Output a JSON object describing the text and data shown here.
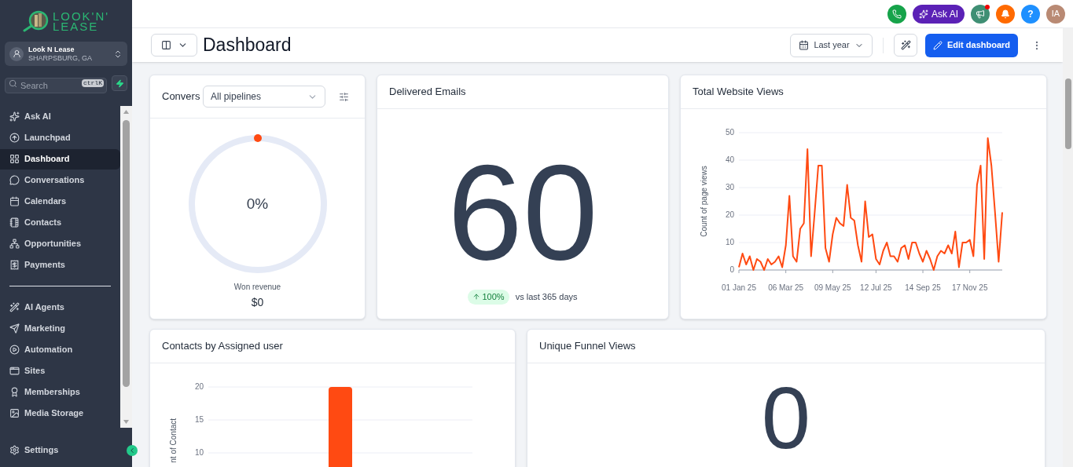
{
  "logo": {
    "line_1": "LOOK'N'",
    "line_2": "LEASE"
  },
  "account": {
    "name": "Look N Lease",
    "location": "SHARPSBURG, GA"
  },
  "search": {
    "placeholder": "Search",
    "shortcut": "ctrlK"
  },
  "sidebar": {
    "groups": [
      {
        "items": [
          {
            "label": "Ask AI",
            "selected": false
          },
          {
            "label": "Launchpad",
            "selected": false
          },
          {
            "label": "Dashboard",
            "selected": true
          },
          {
            "label": "Conversations",
            "selected": false
          },
          {
            "label": "Calendars",
            "selected": false
          },
          {
            "label": "Contacts",
            "selected": false
          },
          {
            "label": "Opportunities",
            "selected": false
          },
          {
            "label": "Payments",
            "selected": false
          }
        ]
      },
      {
        "items": [
          {
            "label": "AI Agents",
            "selected": false
          },
          {
            "label": "Marketing",
            "selected": false
          },
          {
            "label": "Automation",
            "selected": false
          },
          {
            "label": "Sites",
            "selected": false
          },
          {
            "label": "Memberships",
            "selected": false
          },
          {
            "label": "Media Storage",
            "selected": false
          }
        ]
      }
    ],
    "footer_item": "Settings"
  },
  "topbar": {
    "ask_ai": "Ask AI",
    "announcements_unread": true,
    "help": "?",
    "avatar_initials": "IA"
  },
  "header": {
    "title": "Dashboard",
    "date_range": "Last year",
    "edit_button": "Edit dashboard"
  },
  "cards": [
    {
      "kind": "conversion",
      "title": "Convers",
      "select": "All pipelines",
      "reading": "0%",
      "caption": "Won revenue",
      "amount": "$0"
    },
    {
      "kind": "metric",
      "title": "Delivered Emails",
      "value": "60",
      "change": "100%",
      "comparison": "vs last 365 days"
    },
    {
      "kind": "line_chart",
      "title": "Total Website Views",
      "chart_data": {
        "type": "line",
        "ylabel": "Count of page views",
        "categories": [
          "01 Jan 25",
          null,
          null,
          null,
          null,
          null,
          null,
          null,
          null,
          null,
          null,
          null,
          null,
          "06 Mar 25",
          null,
          null,
          null,
          null,
          null,
          null,
          null,
          null,
          null,
          null,
          null,
          null,
          "09 May 25",
          null,
          null,
          null,
          null,
          null,
          null,
          null,
          null,
          null,
          null,
          null,
          "12 Jul 25",
          null,
          null,
          null,
          null,
          null,
          null,
          null,
          null,
          null,
          null,
          null,
          null,
          "14 Sep 25",
          null,
          null,
          null,
          null,
          null,
          null,
          null,
          null,
          null,
          null,
          null,
          null,
          "17 Nov 25",
          null,
          null,
          null,
          null,
          null,
          null,
          null,
          null,
          null
        ],
        "series": [
          {
            "color": "#ff4a12",
            "values": [
              1,
              6,
              2,
              5,
              0,
              4,
              3,
              0,
              4,
              2,
              3,
              5,
              1,
              9,
              27,
              5,
              3,
              15,
              17,
              44,
              5,
              21,
              38,
              38,
              8,
              3,
              13,
              19,
              17,
              16,
              31,
              19,
              18,
              9,
              3,
              25,
              12,
              13,
              4,
              2,
              7,
              10,
              5,
              5,
              3,
              8,
              9,
              4,
              10,
              10,
              6,
              3,
              7,
              4,
              0,
              5,
              7,
              6,
              9,
              6,
              14,
              1,
              10,
              10,
              11,
              5,
              31,
              38,
              4,
              48,
              38,
              21,
              3,
              21
            ]
          }
        ],
        "ylim": [
          0,
          50
        ],
        "yticks": [
          0,
          10,
          20,
          30,
          40,
          50
        ],
        "grid": true
      }
    },
    {
      "kind": "bar_chart",
      "title": "Contacts by Assigned user",
      "chart_data": {
        "type": "bar",
        "ylabel": "nt of Contact",
        "series": [
          {
            "color": "#ff4a12",
            "values": [
              20
            ]
          }
        ],
        "ylim": [
          0,
          20
        ],
        "yticks": [
          10,
          15,
          20
        ],
        "grid": true
      }
    },
    {
      "kind": "metric",
      "title": "Unique Funnel Views",
      "value": "0"
    }
  ]
}
